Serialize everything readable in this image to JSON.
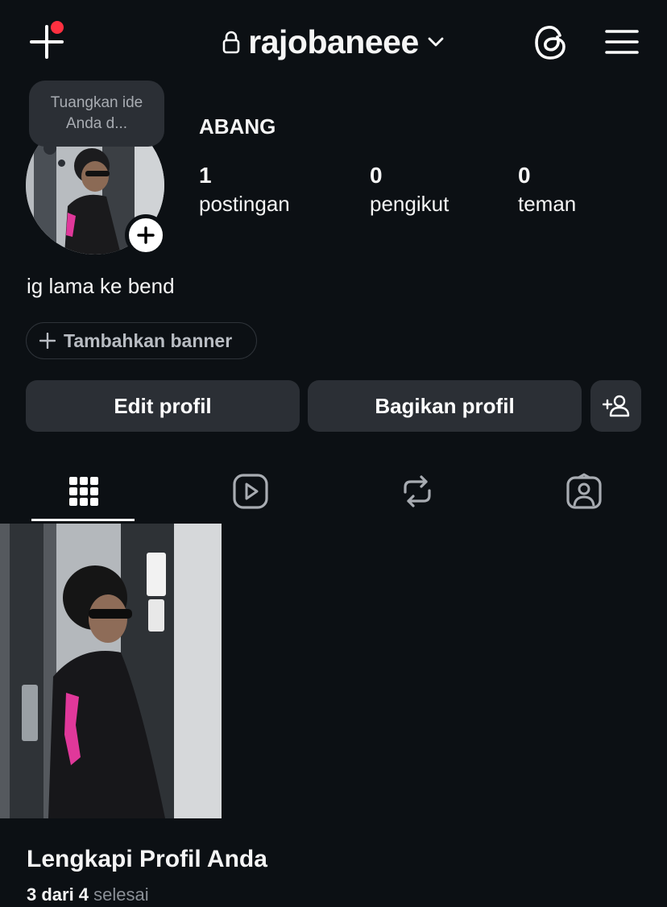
{
  "header": {
    "username": "rajobaneee",
    "notification_color": "#ff3040"
  },
  "note": {
    "placeholder": "Tuangkan ide Anda d..."
  },
  "profile": {
    "display_name": "ABANG",
    "stats": [
      {
        "value": "1",
        "label": "postingan"
      },
      {
        "value": "0",
        "label": "pengikut"
      },
      {
        "value": "0",
        "label": "teman"
      }
    ],
    "bio": "ig lama ke bend"
  },
  "banner": {
    "label": "Tambahkan banner"
  },
  "actions": {
    "edit_label": "Edit profil",
    "share_label": "Bagikan profil"
  },
  "tabs": [
    {
      "icon": "grid-icon",
      "active": true
    },
    {
      "icon": "reels-icon",
      "active": false
    },
    {
      "icon": "reposts-icon",
      "active": false
    },
    {
      "icon": "tagged-icon",
      "active": false
    }
  ],
  "complete_profile": {
    "title": "Lengkapi Profil Anda",
    "progress": "3 dari 4",
    "progress_suffix": "selesai"
  },
  "colors": {
    "background": "#0c1014",
    "button": "#2b2f35",
    "text": "#f5f5f5"
  }
}
